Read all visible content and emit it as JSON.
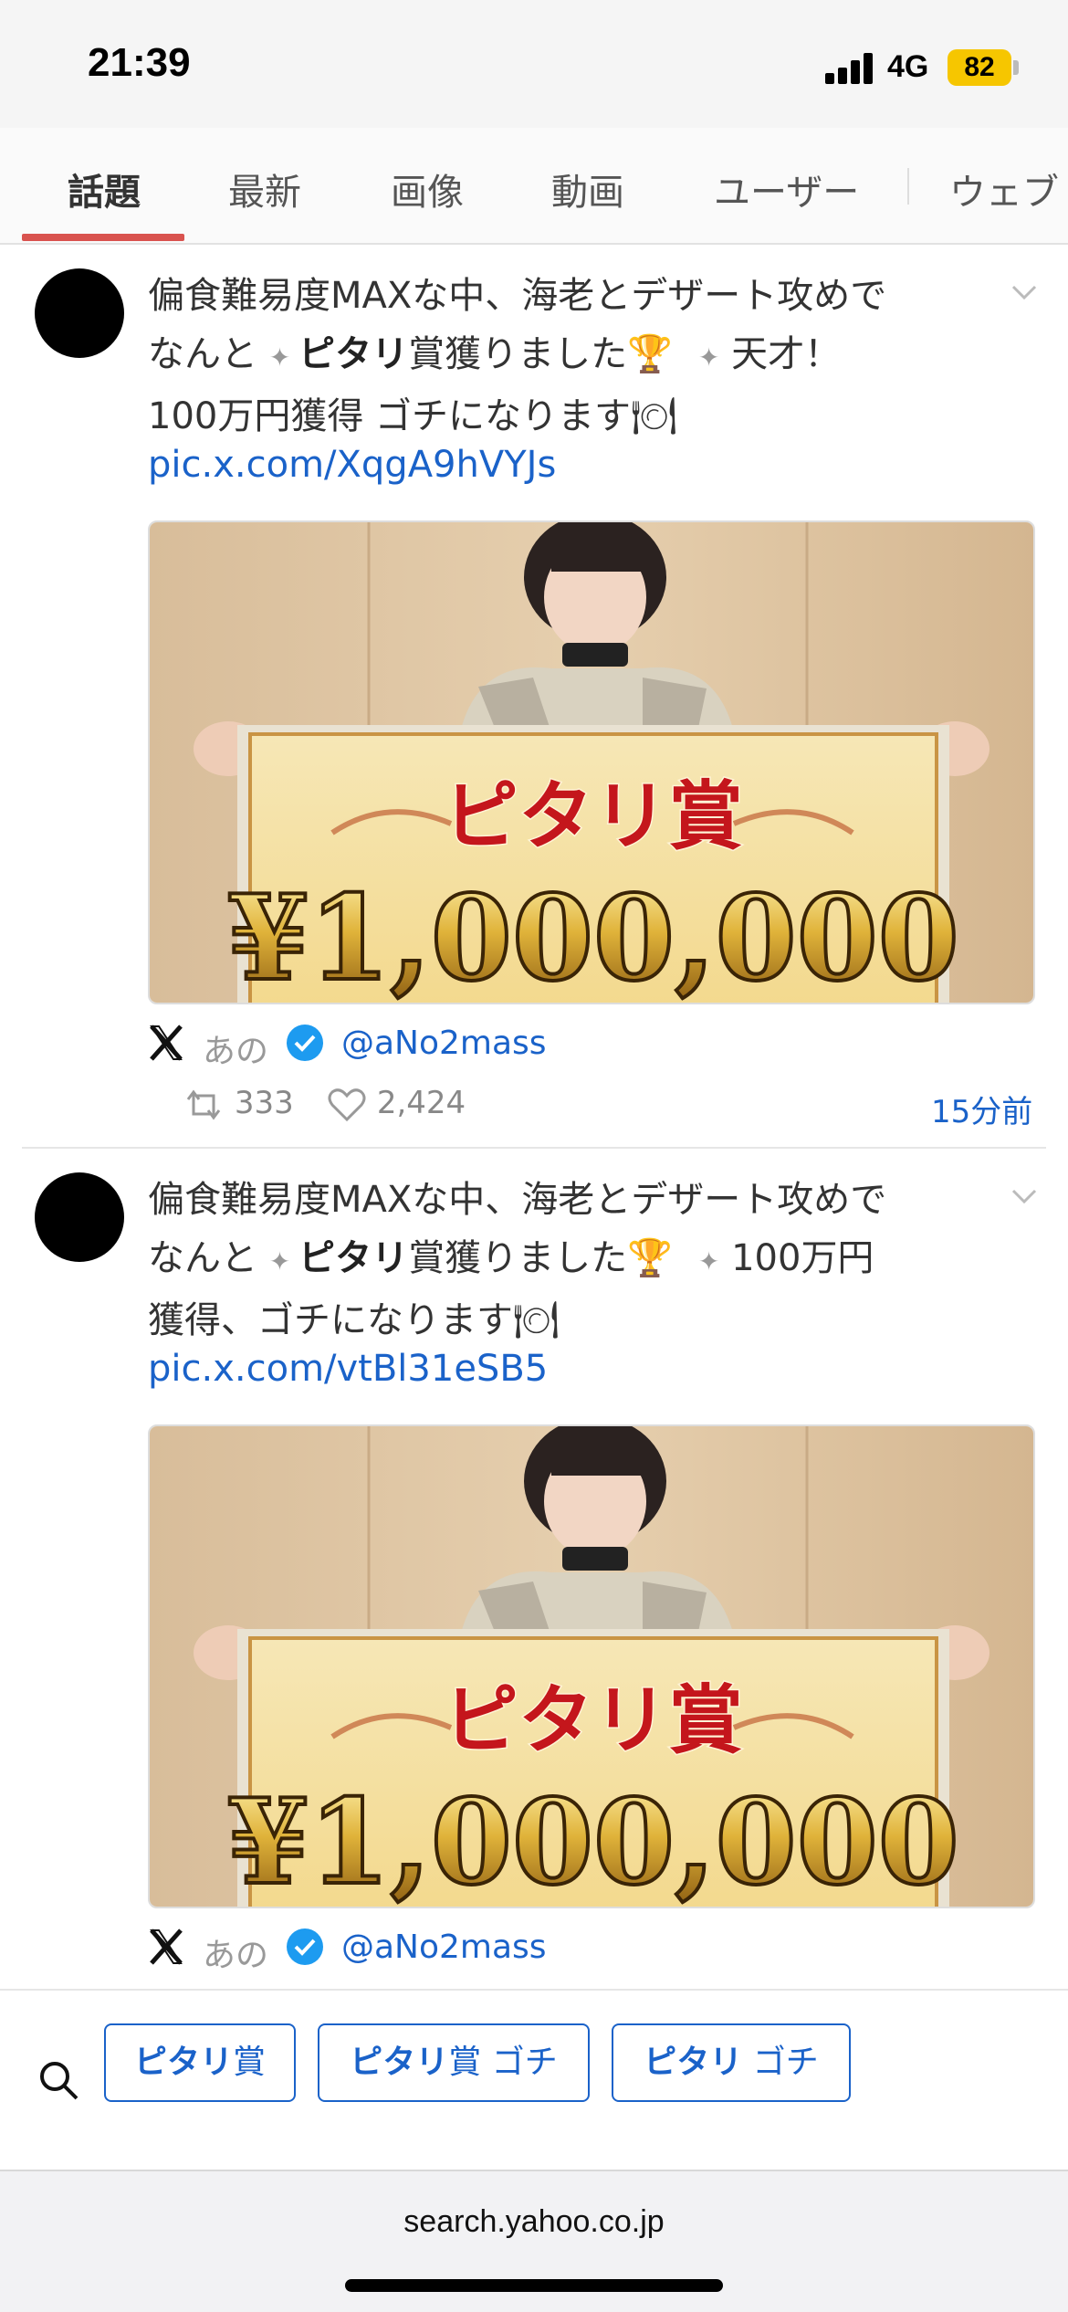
{
  "status": {
    "time": "21:39",
    "network": "4G",
    "battery": "82"
  },
  "tabs": [
    {
      "label": "話題",
      "active": true
    },
    {
      "label": "最新"
    },
    {
      "label": "画像"
    },
    {
      "label": "動画"
    },
    {
      "label": "ユーザー"
    },
    {
      "label": "ウェブ"
    }
  ],
  "posts": [
    {
      "text_1": "偏食難易度MAXな中、海老とデザート攻めで",
      "text_2a": "なんと ",
      "text_2b": "ピタリ",
      "text_2c": "賞獲りました",
      "text_2d": " 天才！",
      "text_3": "100万円獲得 ゴチになります",
      "link": "pic.x.com/XqgA9hVYJs",
      "author": "あの",
      "handle": "@aNo2mass",
      "retweets": "333",
      "likes": "2,424",
      "time_ago": "15分前"
    },
    {
      "text_1": "偏食難易度MAXな中、海老とデザート攻めで",
      "text_2a": "なんと ",
      "text_2b": "ピタリ",
      "text_2c": "賞獲りました",
      "text_2d": " 100万円",
      "text_3": "獲得、ゴチになります",
      "link": "pic.x.com/vtBl31eSB5",
      "author": "あの",
      "handle": "@aNo2mass"
    }
  ],
  "image_sign": {
    "title": "ピタリ賞",
    "amount": "¥1,000,000"
  },
  "suggestions": [
    {
      "bold": "ピタリ",
      "rest": "賞"
    },
    {
      "bold": "ピタリ",
      "rest": "賞 ゴチ"
    },
    {
      "bold": "ピタリ",
      "rest": " ゴチ"
    }
  ],
  "browser": {
    "url": "search.yahoo.co.jp"
  },
  "icons": [
    "signal-icon",
    "battery-icon",
    "chevron-down-icon",
    "x-logo-icon",
    "verified-icon",
    "retweet-icon",
    "heart-icon",
    "search-icon",
    "trophy-icon",
    "plate-icon",
    "sparkle-icon"
  ],
  "colors": {
    "accent": "#d9534f",
    "link": "#1a62c9",
    "battery": "#f6c600"
  }
}
